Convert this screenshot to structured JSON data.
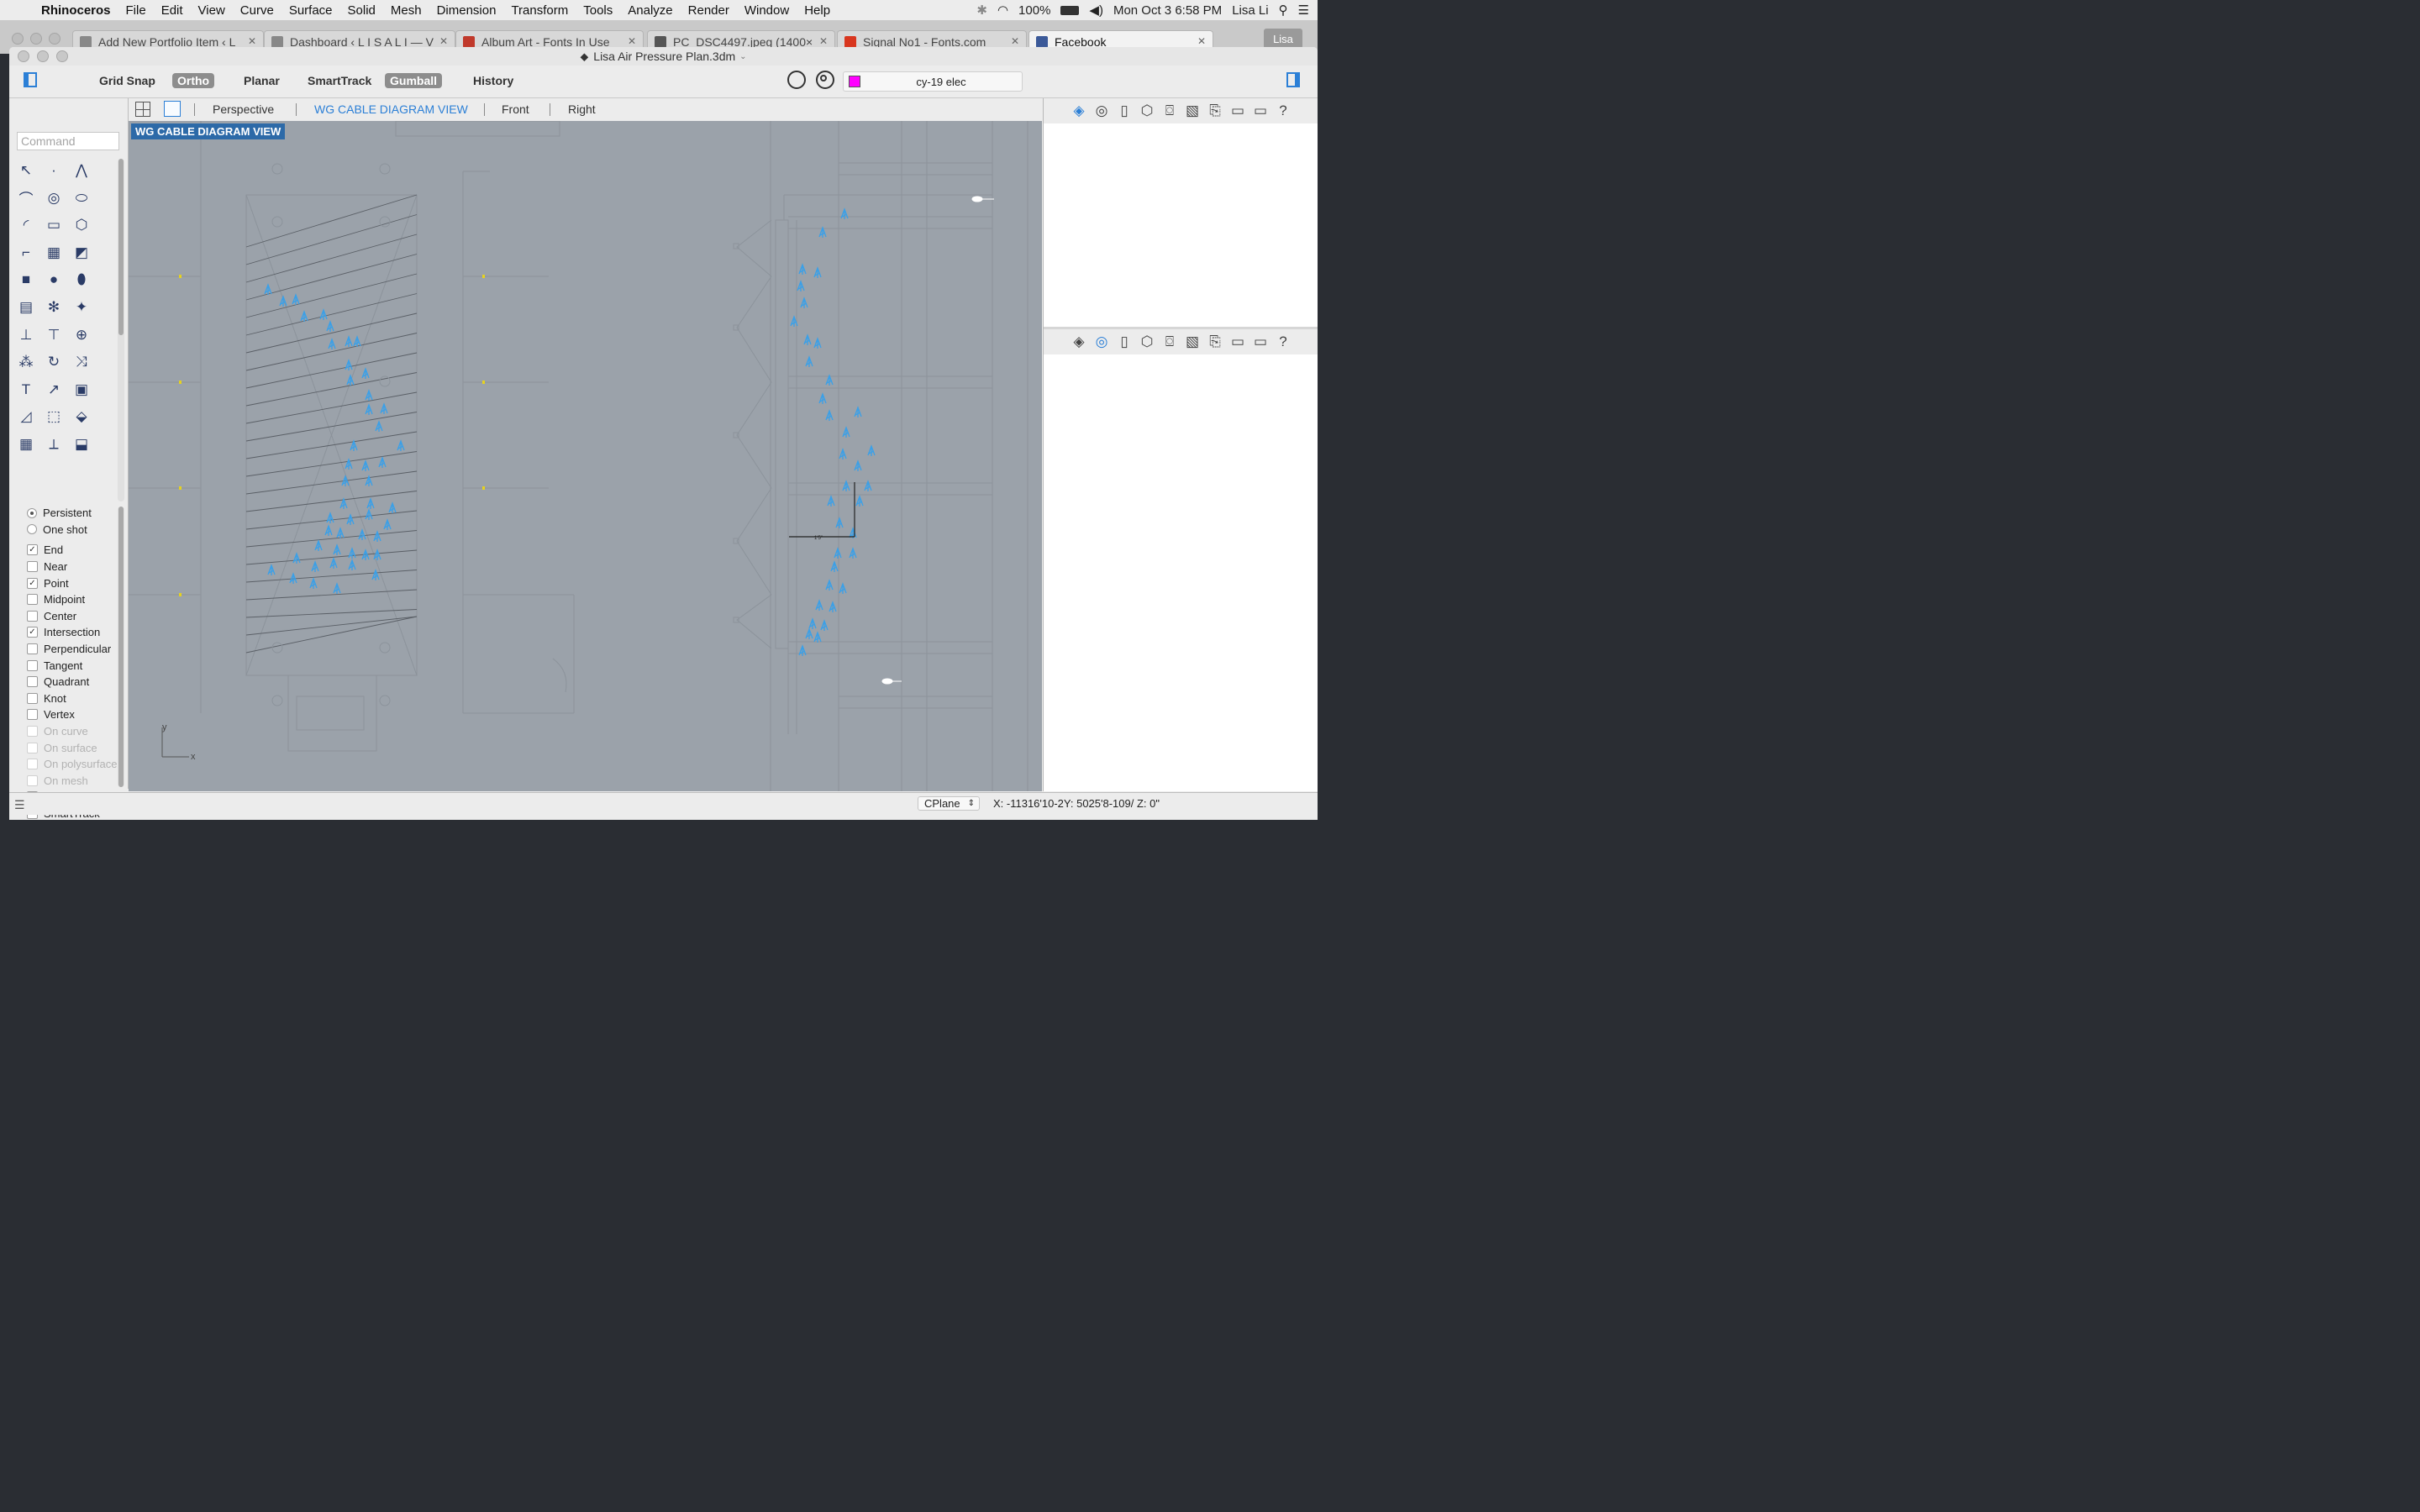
{
  "menubar": {
    "app": "Rhinoceros",
    "items": [
      "File",
      "Edit",
      "View",
      "Curve",
      "Surface",
      "Solid",
      "Mesh",
      "Dimension",
      "Transform",
      "Tools",
      "Analyze",
      "Render",
      "Window",
      "Help"
    ],
    "battery": "100%",
    "datetime": "Mon Oct 3  6:58 PM",
    "user": "Lisa Li"
  },
  "browser": {
    "tabs": [
      {
        "title": "Add New Portfolio Item ‹ L",
        "fav_color": "#888888"
      },
      {
        "title": "Dashboard ‹ L I S A L I — V",
        "fav_color": "#888888"
      },
      {
        "title": "Album Art - Fonts In Use",
        "fav_color": "#c0392b"
      },
      {
        "title": "PC_DSC4497.jpeg (1400×",
        "fav_color": "#555555"
      },
      {
        "title": "Signal No1 - Fonts.com",
        "fav_color": "#d8361e"
      },
      {
        "title": "Facebook",
        "fav_color": "#3b5998"
      }
    ],
    "profile": "Lisa"
  },
  "window": {
    "title": "Lisa Air Pressure Plan.3dm"
  },
  "toolbar": {
    "buttons": [
      {
        "label": "Grid Snap",
        "on": false
      },
      {
        "label": "Ortho",
        "on": true
      },
      {
        "label": "Planar",
        "on": false
      },
      {
        "label": "SmartTrack",
        "on": false
      },
      {
        "label": "Gumball",
        "on": true
      },
      {
        "label": "History",
        "on": false
      }
    ],
    "layer": {
      "name": "cy-19 elec",
      "color": "#ff00ff"
    }
  },
  "command": {
    "placeholder": "Command"
  },
  "viewport_tabs": {
    "tabs": [
      "Perspective",
      "WG CABLE DIAGRAM VIEW",
      "Front",
      "Right"
    ],
    "active": "WG CABLE DIAGRAM VIEW"
  },
  "viewport": {
    "label": "WG CABLE DIAGRAM VIEW",
    "axis_y": "y",
    "axis_x": "x",
    "dim_text": "1'5\""
  },
  "osnap": {
    "mode": [
      {
        "label": "Persistent",
        "selected": true
      },
      {
        "label": "One shot",
        "selected": false
      }
    ],
    "snaps": [
      {
        "label": "End",
        "checked": true,
        "enabled": true
      },
      {
        "label": "Near",
        "checked": false,
        "enabled": true
      },
      {
        "label": "Point",
        "checked": true,
        "enabled": true
      },
      {
        "label": "Midpoint",
        "checked": false,
        "enabled": true
      },
      {
        "label": "Center",
        "checked": false,
        "enabled": true
      },
      {
        "label": "Intersection",
        "checked": true,
        "enabled": true
      },
      {
        "label": "Perpendicular",
        "checked": false,
        "enabled": true
      },
      {
        "label": "Tangent",
        "checked": false,
        "enabled": true
      },
      {
        "label": "Quadrant",
        "checked": false,
        "enabled": true
      },
      {
        "label": "Knot",
        "checked": false,
        "enabled": true
      },
      {
        "label": "Vertex",
        "checked": false,
        "enabled": true
      },
      {
        "label": "On curve",
        "checked": false,
        "enabled": false
      },
      {
        "label": "On surface",
        "checked": false,
        "enabled": false
      },
      {
        "label": "On polysurface",
        "checked": false,
        "enabled": false
      },
      {
        "label": "On mesh",
        "checked": false,
        "enabled": false
      },
      {
        "label": "Project",
        "checked": false,
        "enabled": true
      },
      {
        "label": "SmartTrack",
        "checked": false,
        "enabled": true
      }
    ]
  },
  "status": {
    "cplane": "CPlane",
    "coords": "X: -11316'10-2Y: 5025'8-109/ Z: 0\""
  },
  "colors": {
    "accent": "#2b7fd6",
    "viewport_bg": "#9ba2aa",
    "cable_blue": "#3aa0e8",
    "label_bg": "#2d6aa8"
  },
  "icons": {
    "right_panel": [
      "layers-icon",
      "display-icon",
      "page-icon",
      "box-icon",
      "camera-icon",
      "material-icon",
      "script-icon",
      "frame-icon",
      "monitor-icon",
      "help-icon"
    ]
  }
}
